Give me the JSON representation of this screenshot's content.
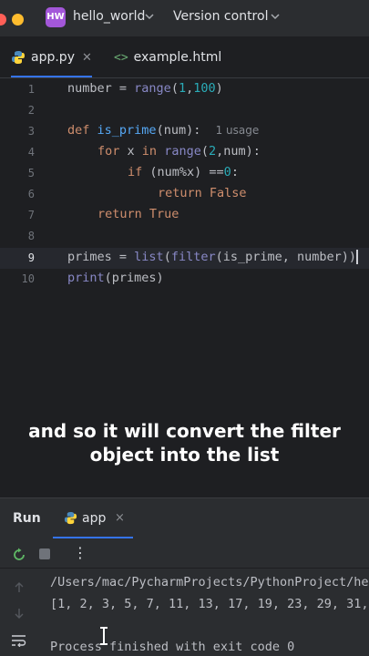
{
  "titlebar": {
    "project_badge": "HW",
    "project_name": "hello_world",
    "vcs_label": "Version control",
    "dot_colors": [
      "#ff5f57",
      "#febc2e",
      "#28c840"
    ]
  },
  "tabs": [
    {
      "label": "app.py",
      "icon": "python-icon",
      "active": true
    },
    {
      "label": "example.html",
      "icon": "html-icon",
      "active": false
    }
  ],
  "editor": {
    "line_numbers": [
      "1",
      "2",
      "3",
      "4",
      "5",
      "6",
      "7",
      "8",
      "9",
      "10"
    ],
    "current_line": "9",
    "usage_hint": "1 usage",
    "lines": {
      "l1_var": "number",
      "l1_eq": " = ",
      "l1_fn": "range",
      "l1_open": "(",
      "l1_a": "1",
      "l1_comma": ",",
      "l1_b": "100",
      "l1_close": ")",
      "l3_def": "def",
      "l3_name": "is_prime",
      "l3_args": "(num):",
      "l4_for": "for",
      "l4_x": " x ",
      "l4_in": "in",
      "l4_range": "range",
      "l4_open": "(",
      "l4_2": "2",
      "l4_rest": ",num):",
      "l5_if": "if",
      "l5_expr": " (num%x) ==",
      "l5_zero": "0",
      "l5_colon": ":",
      "l6_return": "return",
      "l6_false": "False",
      "l7_return": "return",
      "l7_true": "True",
      "l9_var": "primes",
      "l9_eq": " = ",
      "l9_list": "list",
      "l9_open": "(",
      "l9_filter": "filter",
      "l9_args": "(is_prime, number))",
      "l10_print": "print",
      "l10_args": "(primes)"
    }
  },
  "subtitle": {
    "line1": "and so it will convert the filter",
    "line2": "object into the list"
  },
  "run_panel": {
    "label": "Run",
    "tab_label": "app",
    "tab_close": "×"
  },
  "console": {
    "lines": [
      "/Users/mac/PycharmProjects/PythonProject/he",
      "[1, 2, 3, 5, 7, 11, 13, 17, 19, 23, 29, 31,",
      "",
      "Process finished with exit code 0"
    ]
  },
  "colors": {
    "accent": "#3574f0",
    "background": "#1e1f22",
    "panel": "#2b2d30"
  }
}
